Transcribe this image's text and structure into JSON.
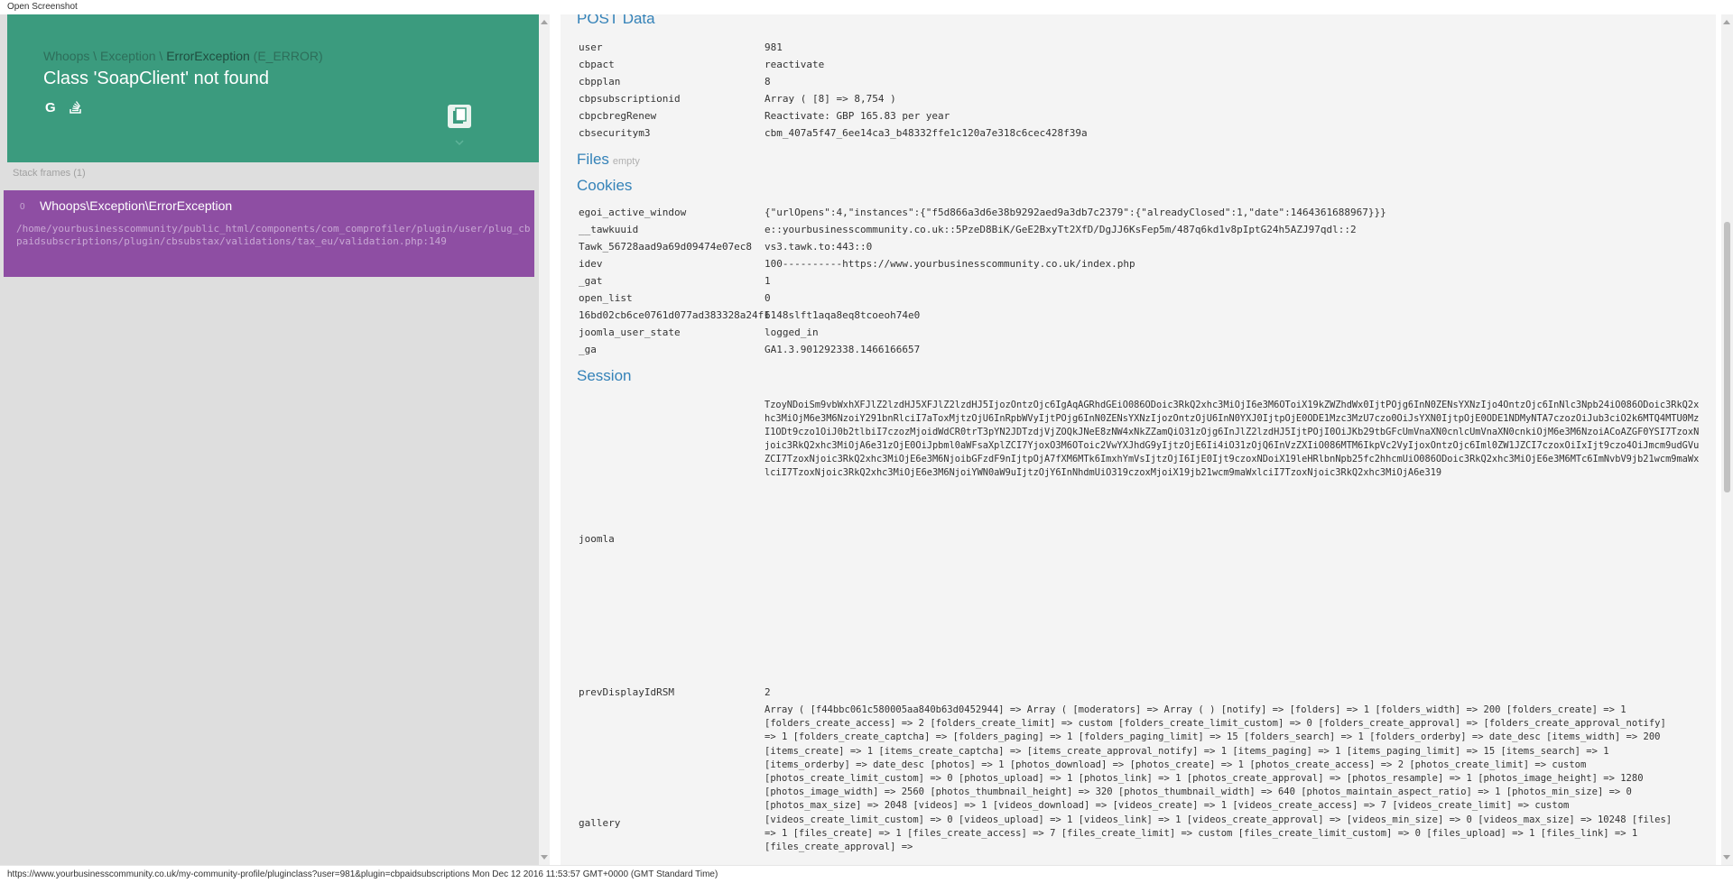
{
  "window": {
    "title": "Open Screenshot"
  },
  "header": {
    "exception_path_prefix": "Whoops \\ Exception \\ ",
    "exception_class": "ErrorException",
    "exception_type": "(E_ERROR)",
    "message": "Class 'SoapClient' not found",
    "icons": [
      "google-icon",
      "stackoverflow-icon",
      "copy-icon",
      "chevron-down-icon"
    ]
  },
  "frames": {
    "label": "Stack frames (1)",
    "items": [
      {
        "index": "0",
        "class": "Whoops\\Exception\\ErrorException",
        "file": "/home/yourbusinesscommunity/public_html/components/com_comprofiler/plugin/user/plug_cbpaidsubscriptions/plugin/cbsubstax/validations/tax_eu/validation.php",
        "line": ":149"
      }
    ]
  },
  "post": {
    "title": "POST Data",
    "rows": [
      {
        "key": "user",
        "value": "981"
      },
      {
        "key": "cbpact",
        "value": "reactivate"
      },
      {
        "key": "cbpplan",
        "value": "8"
      },
      {
        "key": "cbpsubscriptionid",
        "value": "Array ( [8] => 8,754 )"
      },
      {
        "key": "cbpcbregRenew",
        "value": "Reactivate: GBP 165.83 per year"
      },
      {
        "key": "cbsecuritym3",
        "value": "cbm_407a5f47_6ee14ca3_b48332ffe1c120a7e318c6cec428f39a"
      }
    ]
  },
  "files": {
    "title": "Files",
    "empty": "empty"
  },
  "cookies": {
    "title": "Cookies",
    "rows": [
      {
        "key": "egoi_active_window",
        "value": "{\"urlOpens\":4,\"instances\":{\"f5d866a3d6e38b9292aed9a3db7c2379\":{\"alreadyClosed\":1,\"date\":1464361688967}}}"
      },
      {
        "key": "__tawkuuid",
        "value": "e::yourbusinesscommunity.co.uk::5PzeD8BiK/GeE2BxyTt2XfD/DgJJ6KsFep5m/487q6kd1v8pIptG24h5AZJ97qdl::2"
      },
      {
        "key": "Tawk_56728aad9a69d09474e07ec8",
        "value": "vs3.tawk.to:443::0"
      },
      {
        "key": "idev",
        "value": "100----------https://www.yourbusinesscommunity.co.uk/index.php"
      },
      {
        "key": "_gat",
        "value": "1"
      },
      {
        "key": "open_list",
        "value": "0"
      },
      {
        "key": "16bd02cb6ce0761d077ad383328a24f1",
        "value": "6148slft1aqa8eq8tcoeoh74e0"
      },
      {
        "key": "joomla_user_state",
        "value": "logged_in"
      },
      {
        "key": "_ga",
        "value": "GA1.3.901292338.1466166657"
      }
    ]
  },
  "session": {
    "title": "Session",
    "joomla_key": "joomla",
    "joomla_value": "TzoyNDoiSm9vbWxhXFJlZ2lzdHJ5XFJlZ2lzdHJ5IjozOntzOjc6IgAqAGRhdGEiO086ODoic3RkQ2xhc3MiOjI6e3M6OToiX19kZWZhdWx0IjtPOjg6InN0ZENsYXNzIjo4OntzOjc6InNlc3Npb24iO086ODoic3RkQ2xhc3MiOjM6e3M6NzoiY291bnRlciI7aToxMjtzOjU6InRpbWVyIjtPOjg6InN0ZENsYXNzIjozOntzOjU6InN0YXJ0IjtpOjE0ODE1Mzc3MzU7czo0OiJsYXN0IjtpOjE0ODE1NDMyNTA7czozOiJub3ciO2k6MTQ4MTU0MzI1ODt9czo1OiJ0b2tlbiI7czozMjoidWdCR0trT3pYN2JDTzdjVjZOQkJNeE8zNW4xNkZZamQiO31zOjg6InJlZ2lzdHJ5IjtPOjI0OiJKb29tbGFcUmVnaXN0cnlcUmVnaXN0cnkiOjM6e3M6NzoiACoAZGF0YSI7TzoxNjoic3RkQ2xhc3MiOjA6e31zOjE0OiJpbml0aWFsaXplZCI7YjoxO3M6OToic2VwYXJhdG9yIjtzOjE6Ii4iO31zOjQ6InVzZXIiO086MTM6IkpVc2VyIjoxOntzOjc6Iml0ZW1JZCI7czoxOiIxIjt9czo4OiJmcm9udGVuZCI7TzoxNjoic3RkQ2xhc3MiOjE6e3M6NjoibGFzdF9nIjtpOjA7fXM6MTk6ImxhYmVsIjtzOjI6IjE0Ijt9czoxNDoiX19leHRlbnNpb25fc2hhcmUiO086ODoic3RkQ2xhc3MiOjE6e3M6MTc6ImNvbV9jb21wcm9maWxlciI7TzoxNjoic3RkQ2xhc3MiOjE6e3M6NjoiYWN0aW9uIjtzOjY6InNhdmUiO319czoxMjoiX19jb21wcm9maWxlciI7TzoxNjoic3RkQ2xhc3MiOjA6e319",
    "prev_key": "prevDisplayIdRSM",
    "prev_value": "2",
    "gallery_key": "gallery",
    "gallery_value": "Array ( [f44bbc061c580005aa840b63d0452944] => Array ( [moderators] => Array ( ) [notify] => [folders] => 1 [folders_width] => 200 [folders_create] => 1 [folders_create_access] => 2 [folders_create_limit] => custom [folders_create_limit_custom] => 0 [folders_create_approval] => [folders_create_approval_notify] => 1 [folders_create_captcha] => [folders_paging] => 1 [folders_paging_limit] => 15 [folders_search] => 1 [folders_orderby] => date_desc [items_width] => 200 [items_create] => 1 [items_create_captcha] => [items_create_approval_notify] => 1 [items_paging] => 1 [items_paging_limit] => 15 [items_search] => 1 [items_orderby] => date_desc [photos] => 1 [photos_download] => [photos_create] => 1 [photos_create_access] => 2 [photos_create_limit] => custom [photos_create_limit_custom] => 0 [photos_upload] => 1 [photos_link] => 1 [photos_create_approval] => [photos_resample] => 1 [photos_image_height] => 1280 [photos_image_width] => 2560 [photos_thumbnail_height] => 320 [photos_thumbnail_width] => 640 [photos_maintain_aspect_ratio] => 1 [photos_min_size] => 0 [photos_max_size] => 2048 [videos] => 1 [videos_download] => [videos_create] => 1 [videos_create_access] => 7 [videos_create_limit] => custom [videos_create_limit_custom] => 0 [videos_upload] => 1 [videos_link] => 1 [videos_create_approval] => [videos_min_size] => 0 [videos_max_size] => 10248 [files] => 1 [files_create] => 1 [files_create_access] => 7 [files_create_limit] => custom [files_create_limit_custom] => 0 [files_upload] => 1 [files_link] => 1 [files_create_approval] =>"
  },
  "status": {
    "text": "https://www.yourbusinesscommunity.co.uk/my-community-profile/pluginclass?user=981&plugin=cbpaidsubscriptions Mon Dec 12 2016 11:53:57 GMT+0000 (GMT Standard Time)"
  },
  "colors": {
    "header_bg": "#3b9b7e",
    "frame_bg": "#8e4ea3",
    "section_title": "#3482b8"
  }
}
